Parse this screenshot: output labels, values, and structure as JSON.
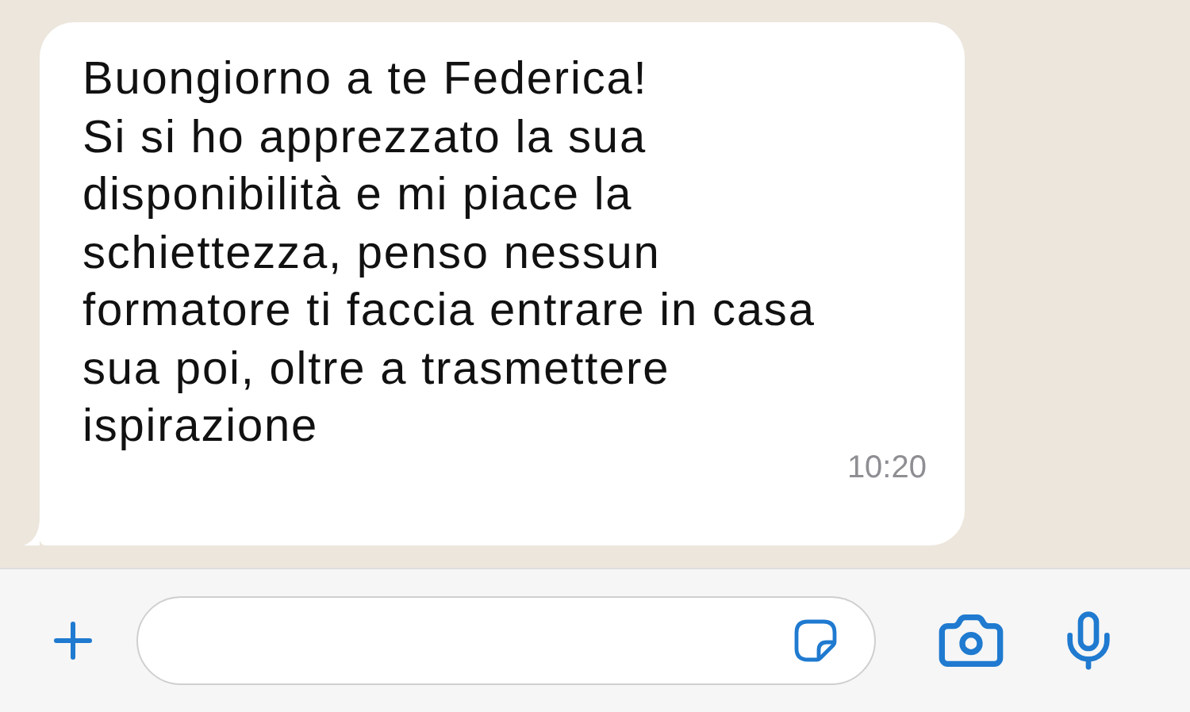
{
  "message": {
    "text": "Buongiorno a te Federica!\nSi si ho apprezzato la sua\ndisponibilità e mi piace la\nschiettezza, penso nessun\nformatore ti faccia entrare in casa\nsua poi, oltre a trasmettere\nispirazione",
    "time": "10:20"
  }
}
